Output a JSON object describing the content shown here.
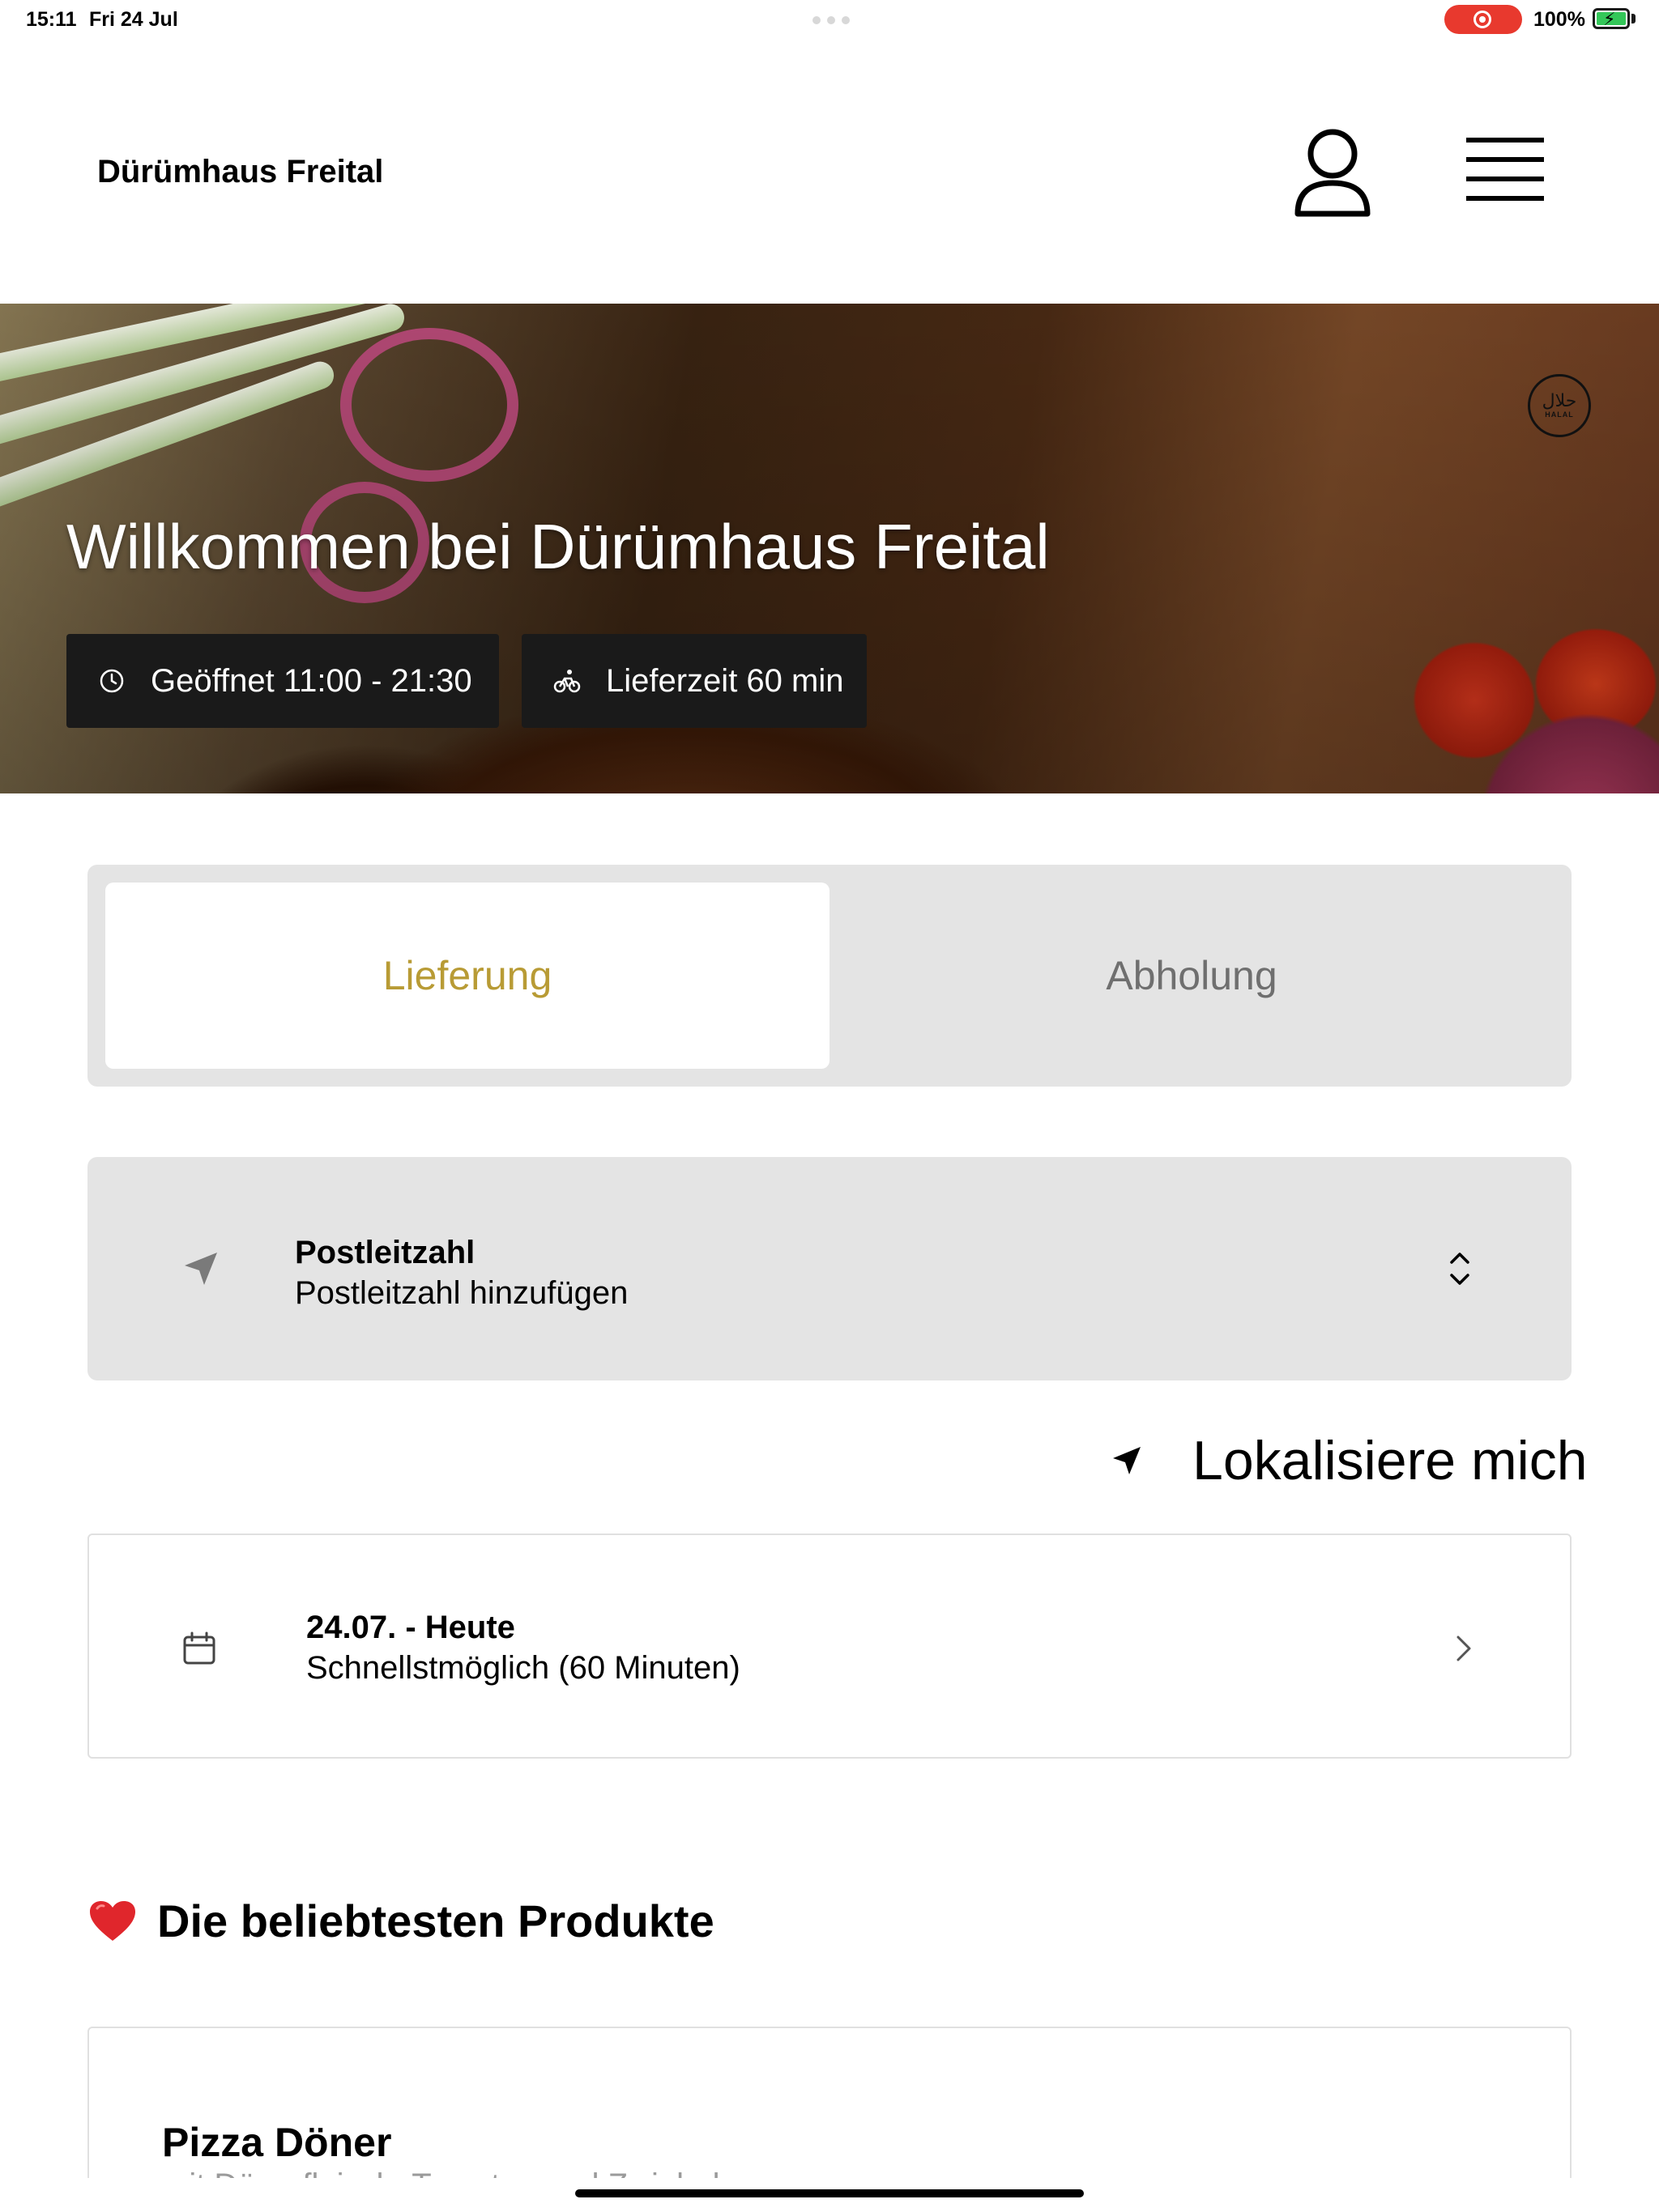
{
  "status_bar": {
    "time": "15:11",
    "date": "Fri 24 Jul",
    "battery": "100%",
    "recording_color": "#e8392e",
    "battery_color": "#34c759"
  },
  "header": {
    "brand": "Dürümhaus Freital",
    "profile_icon": "person-icon",
    "menu_icon": "hamburger-menu-icon"
  },
  "hero": {
    "title": "Willkommen bei Dürümhaus Freital",
    "opening_hours": "Geöffnet 11:00 - 21:30",
    "delivery_time": "Lieferzeit 60 min",
    "halal_arabic": "حلال",
    "halal_latin": "HALAL"
  },
  "order_mode": {
    "delivery_label": "Lieferung",
    "pickup_label": "Abholung",
    "active": "Lieferung",
    "accent_color": "#b89b35"
  },
  "postcode": {
    "label": "Postleitzahl",
    "placeholder": "Postleitzahl hinzufügen"
  },
  "locate": {
    "label": "Lokalisiere mich"
  },
  "delivery_date": {
    "label": "24.07. - Heute",
    "value": "Schnellstmöglich (60 Minuten)"
  },
  "popular": {
    "title": "Die beliebtesten Produkte",
    "products": [
      {
        "name": "Pizza Döner",
        "description": "mit Dönerfleisch, Tomaten und Zwiebeln"
      }
    ]
  }
}
